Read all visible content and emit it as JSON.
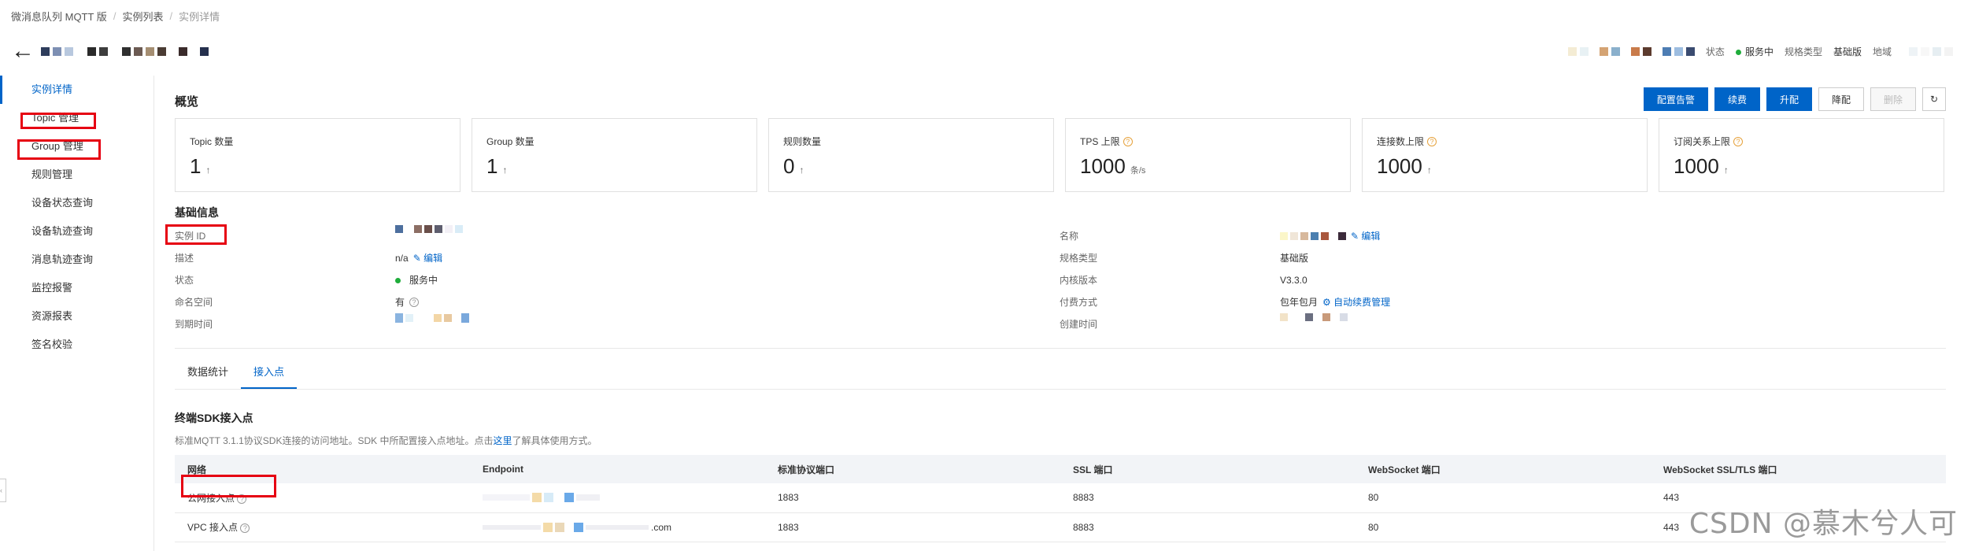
{
  "breadcrumb": [
    "微消息队列 MQTT 版",
    "实例列表",
    "实例详情"
  ],
  "header": {
    "back_icon": "arrow-left-icon",
    "status_label": "状态",
    "status_value": "服务中",
    "spec_label": "规格类型",
    "spec_value": "基础版",
    "region_label": "地域",
    "status_color": "#1fad3b"
  },
  "sidebar": {
    "items": [
      {
        "label": "实例详情"
      },
      {
        "label": "Topic 管理"
      },
      {
        "label": "Group 管理"
      },
      {
        "label": "规则管理"
      },
      {
        "label": "设备状态查询"
      },
      {
        "label": "设备轨迹查询"
      },
      {
        "label": "消息轨迹查询"
      },
      {
        "label": "监控报警"
      },
      {
        "label": "资源报表"
      },
      {
        "label": "签名校验"
      }
    ],
    "active_index": 0
  },
  "overview": {
    "title": "概览",
    "buttons": {
      "alarm": "配置告警",
      "renew": "续费",
      "upgrade": "升配",
      "downgrade": "降配",
      "delete": "删除"
    },
    "cards": [
      {
        "label": "Topic 数量",
        "value": "1",
        "unit": "",
        "has_help": false
      },
      {
        "label": "Group 数量",
        "value": "1",
        "unit": "",
        "has_help": false
      },
      {
        "label": "规则数量",
        "value": "0",
        "unit": "",
        "has_help": false
      },
      {
        "label": "TPS 上限",
        "value": "1000",
        "unit": "条/s",
        "has_help": true
      },
      {
        "label": "连接数上限",
        "value": "1000",
        "unit": "",
        "has_help": true
      },
      {
        "label": "订阅关系上限",
        "value": "1000",
        "unit": "",
        "has_help": true
      }
    ]
  },
  "basic": {
    "title": "基础信息",
    "instance_id_label": "实例 ID",
    "desc_label": "描述",
    "desc_value": "n/a",
    "edit_label": "编辑",
    "status_label": "状态",
    "status_value": "服务中",
    "namespace_label": "命名空间",
    "namespace_value": "有",
    "expire_label": "到期时间",
    "name_label": "名称",
    "spec_label": "规格类型",
    "spec_value": "基础版",
    "kernel_label": "内核版本",
    "kernel_value": "V3.3.0",
    "pay_label": "付费方式",
    "pay_value": "包年包月",
    "auto_renew_label": "自动续费管理",
    "created_label": "创建时间"
  },
  "tabs": [
    "数据统计",
    "接入点"
  ],
  "active_tab": 1,
  "sdk": {
    "title": "终端SDK接入点",
    "desc_prefix": "标准MQTT 3.1.1协议SDK连接的访问地址。SDK 中所配置接入点地址。点击",
    "desc_link": "这里",
    "desc_suffix": "了解具体使用方式。",
    "columns": [
      "网络",
      "Endpoint",
      "标准协议端口",
      "SSL 端口",
      "WebSocket 端口",
      "WebSocket SSL/TLS 端口"
    ],
    "rows": [
      {
        "network": "公网接入点",
        "endpoint_suffix": "",
        "std": "1883",
        "ssl": "8883",
        "ws": "80",
        "wss": "443"
      },
      {
        "network": "VPC 接入点",
        "endpoint_suffix": ".com",
        "std": "1883",
        "ssl": "8883",
        "ws": "80",
        "wss": "443"
      }
    ]
  },
  "watermark": "CSDN @慕木兮人可"
}
